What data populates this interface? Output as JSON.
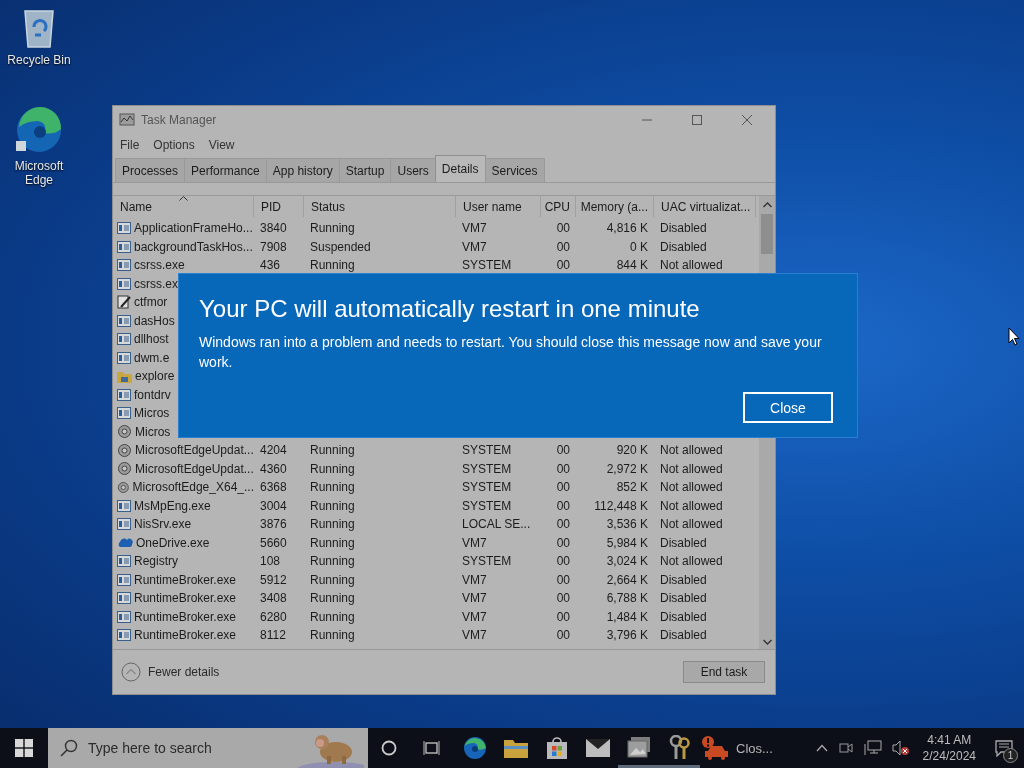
{
  "desktop_icons": [
    {
      "kind": "recycle",
      "label": "Recycle Bin"
    },
    {
      "kind": "edge",
      "label": "Microsoft Edge"
    }
  ],
  "task_manager": {
    "title": "Task Manager",
    "menu": [
      "File",
      "Options",
      "View"
    ],
    "tabs": [
      {
        "label": "Processes",
        "selected": false
      },
      {
        "label": "Performance",
        "selected": false
      },
      {
        "label": "App history",
        "selected": false
      },
      {
        "label": "Startup",
        "selected": false
      },
      {
        "label": "Users",
        "selected": false
      },
      {
        "label": "Details",
        "selected": true
      },
      {
        "label": "Services",
        "selected": false
      }
    ],
    "columns": [
      {
        "label": "Name",
        "sorted": true
      },
      {
        "label": "PID",
        "sorted": false
      },
      {
        "label": "Status",
        "sorted": false
      },
      {
        "label": "User name",
        "sorted": false
      },
      {
        "label": "CPU",
        "sorted": false
      },
      {
        "label": "Memory (a...",
        "sorted": false
      },
      {
        "label": "UAC virtualizat...",
        "sorted": false
      }
    ],
    "rows": [
      {
        "kind": "app",
        "cells": [
          "ApplicationFrameHo...",
          "3840",
          "Running",
          "VM7",
          "00",
          "4,816 K",
          "Disabled"
        ]
      },
      {
        "kind": "app",
        "cells": [
          "backgroundTaskHos...",
          "7908",
          "Suspended",
          "VM7",
          "00",
          "0 K",
          "Disabled"
        ]
      },
      {
        "kind": "app",
        "cells": [
          "csrss.exe",
          "436",
          "Running",
          "SYSTEM",
          "00",
          "844 K",
          "Not allowed"
        ]
      },
      {
        "kind": "app",
        "cells": [
          "csrss.ex"
        ]
      },
      {
        "kind": "edit",
        "cells": [
          "ctfmor"
        ]
      },
      {
        "kind": "app",
        "cells": [
          "dasHos"
        ]
      },
      {
        "kind": "app",
        "cells": [
          "dllhost"
        ]
      },
      {
        "kind": "app",
        "cells": [
          "dwm.e"
        ]
      },
      {
        "kind": "folder",
        "cells": [
          "explore"
        ]
      },
      {
        "kind": "app",
        "cells": [
          "fontdrv"
        ]
      },
      {
        "kind": "app",
        "cells": [
          "Micros"
        ]
      },
      {
        "kind": "updater",
        "cells": [
          "Micros"
        ]
      },
      {
        "kind": "updater",
        "cells": [
          "MicrosoftEdgeUpdat...",
          "4204",
          "Running",
          "SYSTEM",
          "00",
          "920 K",
          "Not allowed"
        ]
      },
      {
        "kind": "updater",
        "cells": [
          "MicrosoftEdgeUpdat...",
          "4360",
          "Running",
          "SYSTEM",
          "00",
          "2,972 K",
          "Not allowed"
        ]
      },
      {
        "kind": "updater",
        "cells": [
          "MicrosoftEdge_X64_...",
          "6368",
          "Running",
          "SYSTEM",
          "00",
          "852 K",
          "Not allowed"
        ]
      },
      {
        "kind": "app",
        "cells": [
          "MsMpEng.exe",
          "3004",
          "Running",
          "SYSTEM",
          "00",
          "112,448 K",
          "Not allowed"
        ]
      },
      {
        "kind": "app",
        "cells": [
          "NisSrv.exe",
          "3876",
          "Running",
          "LOCAL SE...",
          "00",
          "3,536 K",
          "Not allowed"
        ]
      },
      {
        "kind": "cloud",
        "cells": [
          "OneDrive.exe",
          "5660",
          "Running",
          "VM7",
          "00",
          "5,984 K",
          "Disabled"
        ]
      },
      {
        "kind": "app",
        "cells": [
          "Registry",
          "108",
          "Running",
          "SYSTEM",
          "00",
          "3,024 K",
          "Not allowed"
        ]
      },
      {
        "kind": "app",
        "cells": [
          "RuntimeBroker.exe",
          "5912",
          "Running",
          "VM7",
          "00",
          "2,664 K",
          "Disabled"
        ]
      },
      {
        "kind": "app",
        "cells": [
          "RuntimeBroker.exe",
          "3408",
          "Running",
          "VM7",
          "00",
          "6,788 K",
          "Disabled"
        ]
      },
      {
        "kind": "app",
        "cells": [
          "RuntimeBroker.exe",
          "6280",
          "Running",
          "VM7",
          "00",
          "1,484 K",
          "Disabled"
        ]
      },
      {
        "kind": "app",
        "cells": [
          "RuntimeBroker.exe",
          "8112",
          "Running",
          "VM7",
          "00",
          "3,796 K",
          "Disabled"
        ]
      }
    ],
    "fewer_details": "Fewer details",
    "end_task": "End task"
  },
  "dialog": {
    "title": "Your PC will automatically restart in one minute",
    "message": "Windows ran into a problem and needs to restart. You should close this message now and save your work.",
    "button": "Close"
  },
  "taskbar": {
    "search": {
      "placeholder": "Type here to search"
    },
    "apps": [
      {
        "kind": "edge",
        "running": false
      },
      {
        "kind": "folder",
        "running": false
      },
      {
        "kind": "store",
        "running": false
      },
      {
        "kind": "mail",
        "running": false
      },
      {
        "kind": "photos",
        "running": true
      },
      {
        "kind": "keys",
        "running": true
      },
      {
        "kind": "car",
        "label": "Clos...",
        "running": false
      }
    ],
    "time": "4:41 AM",
    "date": "2/24/2024",
    "notifications": "1"
  }
}
